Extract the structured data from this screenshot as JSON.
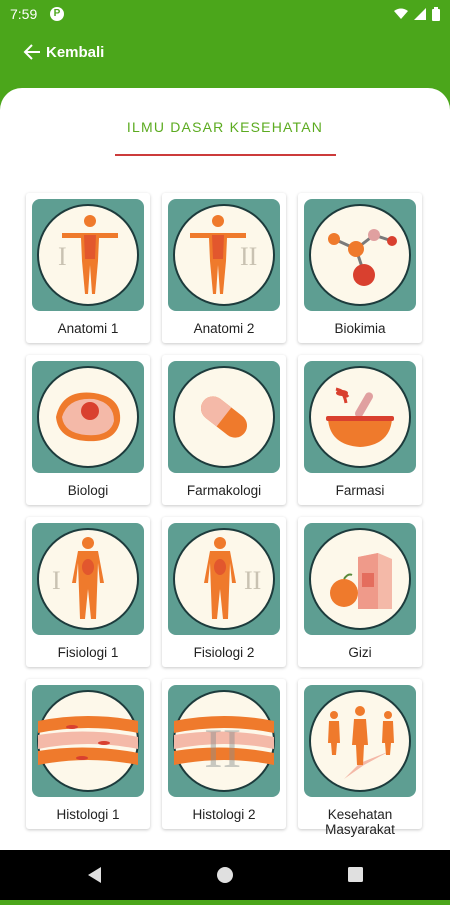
{
  "status_bar": {
    "time": "7:59",
    "app_badge": "P",
    "icons": [
      "wifi-icon",
      "signal-icon",
      "battery-icon"
    ]
  },
  "app_bar": {
    "back_label": "Kembali"
  },
  "page": {
    "title": "ILMU DASAR KESEHATAN"
  },
  "subjects": [
    {
      "label": "Anatomi 1",
      "icon": "anatomy-body-icon",
      "numeral": "I"
    },
    {
      "label": "Anatomi 2",
      "icon": "anatomy-body-icon",
      "numeral": "II"
    },
    {
      "label": "Biokimia",
      "icon": "molecule-icon"
    },
    {
      "label": "Biologi",
      "icon": "cell-icon"
    },
    {
      "label": "Farmakologi",
      "icon": "pill-capsule-icon"
    },
    {
      "label": "Farmasi",
      "icon": "mortar-pestle-icon"
    },
    {
      "label": "Fisiologi 1",
      "icon": "physiology-body-icon",
      "numeral": "I"
    },
    {
      "label": "Fisiologi 2",
      "icon": "physiology-body-icon",
      "numeral": "II"
    },
    {
      "label": "Gizi",
      "icon": "apple-milk-icon"
    },
    {
      "label": "Histologi 1",
      "icon": "muscle-tissue-icon"
    },
    {
      "label": "Histologi 2",
      "icon": "muscle-tissue-icon",
      "numeral": "II"
    },
    {
      "label": "Kesehatan Masyarakat",
      "icon": "people-group-icon"
    }
  ],
  "colors": {
    "brand_green": "#4ba61b",
    "title_green": "#5cab20",
    "underline_red": "#cc3b3b",
    "tile_teal": "#5e9e92",
    "circle_cream": "#fdf8ea",
    "illustration_orange": "#ef7a2c"
  },
  "nav_bar": {
    "buttons": [
      "back-triangle-icon",
      "home-circle-icon",
      "recents-square-icon"
    ]
  }
}
